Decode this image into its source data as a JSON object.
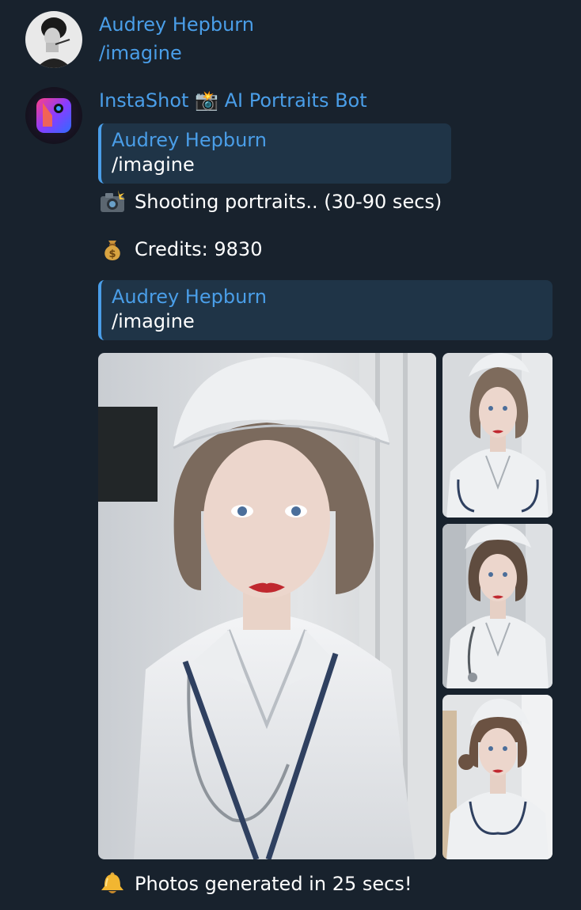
{
  "messages": {
    "user": {
      "name": "Audrey Hepburn",
      "text": "/imagine"
    },
    "bot": {
      "name": "InstaShot 📸 AI Portraits Bot",
      "reply1": {
        "quote_name": "Audrey Hepburn",
        "quote_text": "/imagine",
        "status": "Shooting portraits.. (30-90 secs)",
        "status_icon": "camera-flash-icon",
        "credits": "Credits: 9830",
        "credits_icon": "money-bag-icon"
      },
      "reply2": {
        "quote_name": "Audrey Hepburn",
        "quote_text": "/imagine",
        "photos": [
          "portrait-main",
          "portrait-2",
          "portrait-3",
          "portrait-4"
        ],
        "result": "Photos generated in 25 secs!",
        "result_icon": "bell-icon"
      }
    }
  },
  "colors": {
    "background": "#18222d",
    "accent": "#4a9ee8",
    "quote_bg": "#1f3447",
    "text": "#ffffff"
  }
}
